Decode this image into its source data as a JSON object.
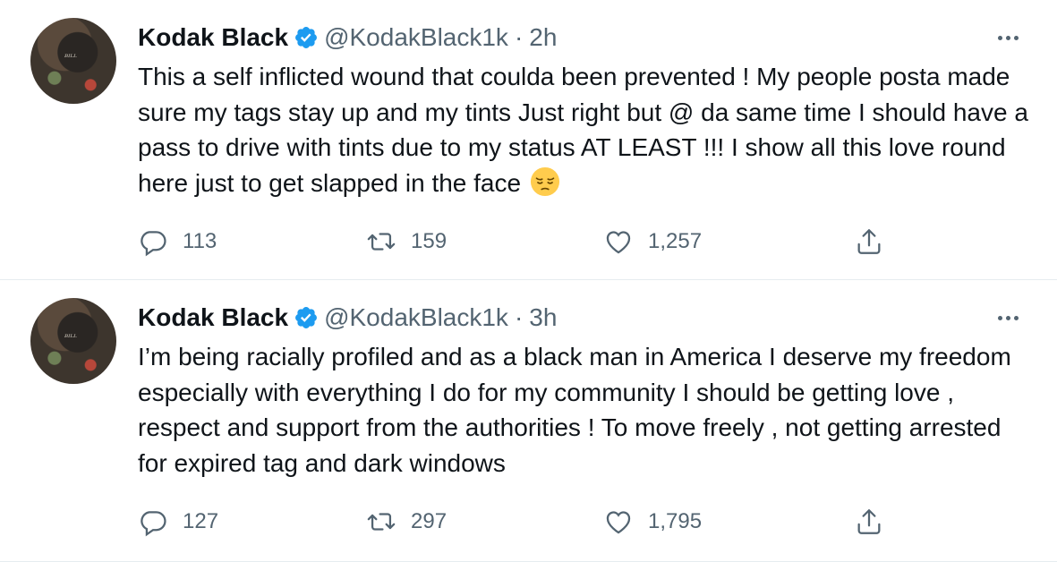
{
  "tweets": [
    {
      "display_name": "Kodak Black",
      "handle": "@KodakBlack1k",
      "separator": "·",
      "time": "2h",
      "text": "This a self inflicted wound that coulda been prevented ! My people posta made sure my tags stay up and my tints Just right but @ da same time I should have a pass to drive with tints due to my status AT LEAST !!! I show all this love round here just to get slapped in the face",
      "emoji": "pensive-face",
      "replies": "113",
      "retweets": "159",
      "likes": "1,257"
    },
    {
      "display_name": "Kodak Black",
      "handle": "@KodakBlack1k",
      "separator": "·",
      "time": "3h",
      "text": "I’m being racially profiled and as a black man in America I deserve my freedom especially with everything I do for my community I should be getting love , respect and support from the authorities ! To move freely , not getting arrested for expired tag and dark windows",
      "replies": "127",
      "retweets": "297",
      "likes": "1,795"
    }
  ],
  "icons": {
    "verified": "verified-badge-icon",
    "more": "more-icon",
    "reply": "reply-icon",
    "retweet": "retweet-icon",
    "like": "like-icon",
    "share": "share-icon"
  },
  "colors": {
    "verified_blue": "#1d9bf0",
    "secondary_text": "#536471",
    "primary_text": "#0f1419",
    "divider": "#e6ecf0"
  }
}
